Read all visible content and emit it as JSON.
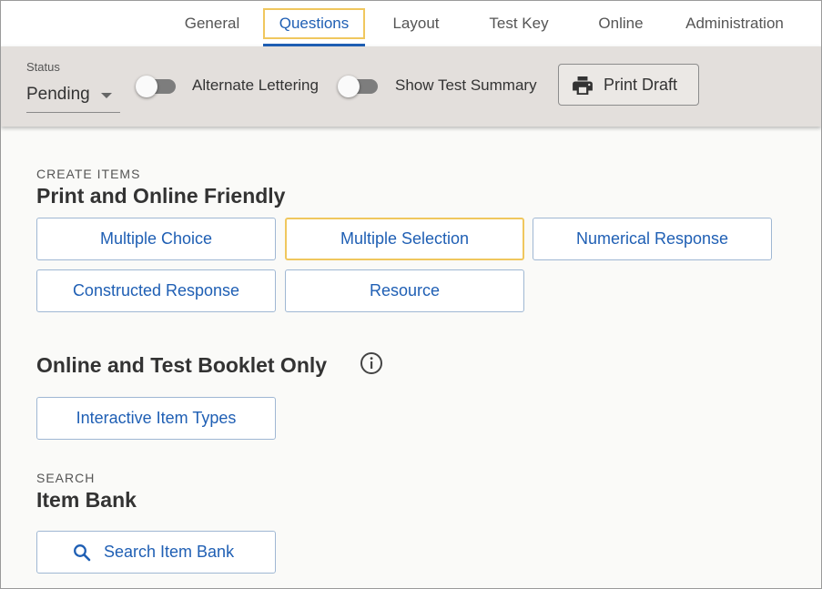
{
  "tabs": [
    {
      "label": "General"
    },
    {
      "label": "Questions",
      "active": true
    },
    {
      "label": "Layout"
    },
    {
      "label": "Test Key"
    },
    {
      "label": "Online"
    },
    {
      "label": "Administration"
    }
  ],
  "toolbar": {
    "status_label": "Status",
    "status_value": "Pending",
    "alternate_lettering_label": "Alternate Lettering",
    "show_test_summary_label": "Show Test Summary",
    "print_draft_label": "Print Draft"
  },
  "create_items": {
    "overline": "CREATE ITEMS",
    "heading": "Print and Online Friendly",
    "buttons": [
      {
        "label": "Multiple Choice"
      },
      {
        "label": "Multiple Selection"
      },
      {
        "label": "Numerical Response"
      },
      {
        "label": "Constructed Response"
      },
      {
        "label": "Resource"
      }
    ]
  },
  "online_only": {
    "heading": "Online and Test Booklet Only",
    "interactive_label": "Interactive Item Types"
  },
  "search": {
    "overline": "SEARCH",
    "heading": "Item Bank",
    "button_label": "Search Item Bank"
  },
  "colors": {
    "accent": "#1f5fb4",
    "focus": "#f0c75e",
    "toolbar_bg": "#e3dfdc"
  },
  "icons": {
    "print": "printer-icon",
    "info": "info-icon",
    "search": "search-icon"
  }
}
